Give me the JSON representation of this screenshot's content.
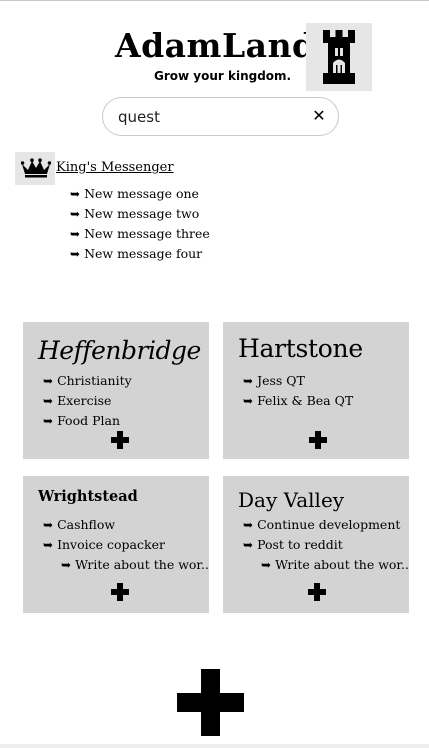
{
  "header": {
    "title": "AdamLand",
    "tagline": "Grow your kingdom.",
    "logo_icon": "castle-icon"
  },
  "search": {
    "value": "quest",
    "placeholder": "",
    "clear_label": "✕"
  },
  "messenger": {
    "icon": "crown-icon",
    "label": "King's Messenger",
    "messages": [
      "New message one",
      "New message two",
      "New message three",
      "New message four"
    ]
  },
  "bullet": "➥",
  "add_icon": "plus-icon",
  "cards": [
    {
      "title": "Heffenbridge",
      "items": [
        "Christianity",
        "Exercise",
        "Food Plan"
      ]
    },
    {
      "title": "Hartstone",
      "items": [
        "Jess QT",
        "Felix & Bea QT"
      ]
    },
    {
      "title": "Wrightstead",
      "items": [
        "Cashflow",
        "Invoice copacker"
      ],
      "sub_items": [
        "Write about the wor.."
      ]
    },
    {
      "title": "Day Valley",
      "items": [
        "Continue development",
        "Post to reddit"
      ],
      "sub_items": [
        "Write about the wor.."
      ]
    }
  ],
  "colors": {
    "card_bg": "#d3d3d3",
    "icon_bg": "#e6e6e6"
  }
}
